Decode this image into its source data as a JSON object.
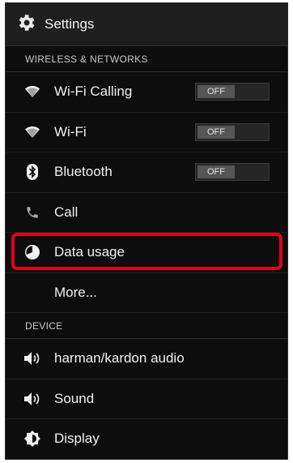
{
  "actionbar": {
    "title": "Settings",
    "icon": "gear-icon"
  },
  "sections": {
    "wireless": "WIRELESS & NETWORKS",
    "device": "DEVICE"
  },
  "items": {
    "wifi_calling": {
      "label": "Wi-Fi Calling",
      "icon": "wifi-icon",
      "toggle": "OFF"
    },
    "wifi": {
      "label": "Wi-Fi",
      "icon": "wifi-icon",
      "toggle": "OFF"
    },
    "bluetooth": {
      "label": "Bluetooth",
      "icon": "bluetooth-icon",
      "toggle": "OFF"
    },
    "call": {
      "label": "Call",
      "icon": "phone-icon"
    },
    "data_usage": {
      "label": "Data usage",
      "icon": "data-usage-icon",
      "highlighted": true
    },
    "more": {
      "label": "More..."
    },
    "audio": {
      "label": "harman/kardon audio",
      "icon": "speaker-icon"
    },
    "sound": {
      "label": "Sound",
      "icon": "speaker-icon"
    },
    "display": {
      "label": "Display",
      "icon": "brightness-icon"
    }
  },
  "colors": {
    "highlight": "#e3001b",
    "background": "#0d0d0d"
  }
}
